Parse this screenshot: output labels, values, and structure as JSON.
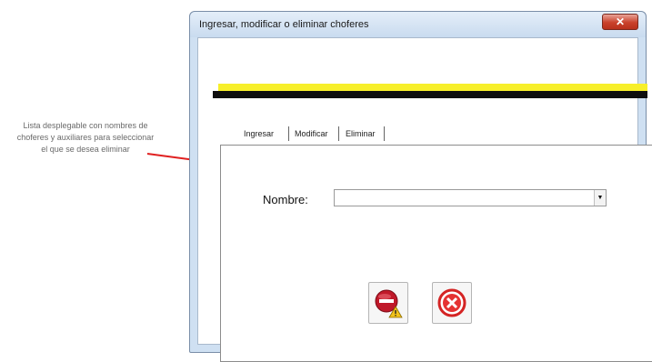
{
  "annotation": {
    "text": "Lista desplegable con nombres de choferes y auxiliares para seleccionar el que se desea eliminar"
  },
  "window": {
    "title": "Ingresar, modificar o eliminar choferes",
    "close_label": "✕"
  },
  "tabs": [
    {
      "label": "Ingresar"
    },
    {
      "label": "Modificar"
    },
    {
      "label": "Eliminar"
    }
  ],
  "active_tab": "Eliminar",
  "form": {
    "name_label": "Nombre:",
    "name_value": "",
    "dropdown_icon": "chevron-down-icon"
  },
  "actions": {
    "delete_icon": "delete-user-icon",
    "cancel_icon": "cancel-icon"
  },
  "colors": {
    "accent_yellow": "#f7ef2a",
    "accent_black": "#0f0f0f",
    "arrow_red": "#e02020",
    "delete_red": "#c0192a",
    "cancel_red": "#e53232"
  }
}
